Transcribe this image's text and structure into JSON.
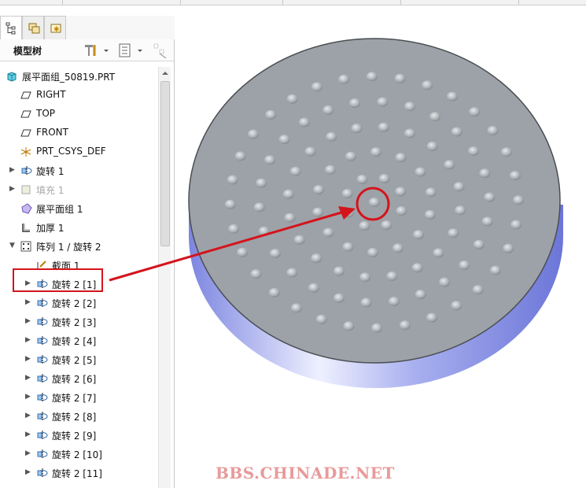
{
  "panel_tabs": [
    "model-tree-tab",
    "layers-tab",
    "favorites-tab"
  ],
  "tree_title": "模型树",
  "tree_items": [
    {
      "label": "展平面组_50819.PRT",
      "icon": "part-icon",
      "expand": "",
      "depth": 0,
      "dim": false
    },
    {
      "label": "RIGHT",
      "icon": "datum-plane-icon",
      "expand": "",
      "depth": 1,
      "dim": false
    },
    {
      "label": "TOP",
      "icon": "datum-plane-icon",
      "expand": "",
      "depth": 1,
      "dim": false
    },
    {
      "label": "FRONT",
      "icon": "datum-plane-icon",
      "expand": "",
      "depth": 1,
      "dim": false
    },
    {
      "label": "PRT_CSYS_DEF",
      "icon": "csys-icon",
      "expand": "",
      "depth": 1,
      "dim": false
    },
    {
      "label": "旋转 1",
      "icon": "revolve-icon",
      "expand": "▶",
      "depth": 1,
      "dim": false
    },
    {
      "label": "填充 1",
      "icon": "fill-icon",
      "expand": "▶",
      "depth": 1,
      "dim": true
    },
    {
      "label": "展平面组 1",
      "icon": "flatten-quilt-icon",
      "expand": "",
      "depth": 1,
      "dim": false
    },
    {
      "label": "加厚 1",
      "icon": "thicken-icon",
      "expand": "",
      "depth": 1,
      "dim": false
    },
    {
      "label": "阵列 1 / 旋转 2",
      "icon": "pattern-icon",
      "expand": "▼",
      "depth": 1,
      "dim": false
    },
    {
      "label": "截面 1",
      "icon": "sketch-icon",
      "expand": "",
      "depth": 2,
      "dim": false
    },
    {
      "label": "旋转 2 [1]",
      "icon": "revolve-icon",
      "expand": "▶",
      "depth": 2,
      "dim": false
    },
    {
      "label": "旋转 2 [2]",
      "icon": "revolve-icon",
      "expand": "▶",
      "depth": 2,
      "dim": false
    },
    {
      "label": "旋转 2 [3]",
      "icon": "revolve-icon",
      "expand": "▶",
      "depth": 2,
      "dim": false
    },
    {
      "label": "旋转 2 [4]",
      "icon": "revolve-icon",
      "expand": "▶",
      "depth": 2,
      "dim": false
    },
    {
      "label": "旋转 2 [5]",
      "icon": "revolve-icon",
      "expand": "▶",
      "depth": 2,
      "dim": false
    },
    {
      "label": "旋转 2 [6]",
      "icon": "revolve-icon",
      "expand": "▶",
      "depth": 2,
      "dim": false
    },
    {
      "label": "旋转 2 [7]",
      "icon": "revolve-icon",
      "expand": "▶",
      "depth": 2,
      "dim": false
    },
    {
      "label": "旋转 2 [8]",
      "icon": "revolve-icon",
      "expand": "▶",
      "depth": 2,
      "dim": false
    },
    {
      "label": "旋转 2 [9]",
      "icon": "revolve-icon",
      "expand": "▶",
      "depth": 2,
      "dim": false
    },
    {
      "label": "旋转 2 [10]",
      "icon": "revolve-icon",
      "expand": "▶",
      "depth": 2,
      "dim": false
    },
    {
      "label": "旋转 2 [11]",
      "icon": "revolve-icon",
      "expand": "▶",
      "depth": 2,
      "dim": false
    }
  ],
  "highlighted_item": "旋转 2 [1]",
  "colors": {
    "annotation_red": "#d4141c",
    "disk_top": "#9ea3a9",
    "disk_side": "#8f97e6",
    "bump": "#b9bdc2"
  },
  "watermark": "BBS.CHINADE.NET"
}
